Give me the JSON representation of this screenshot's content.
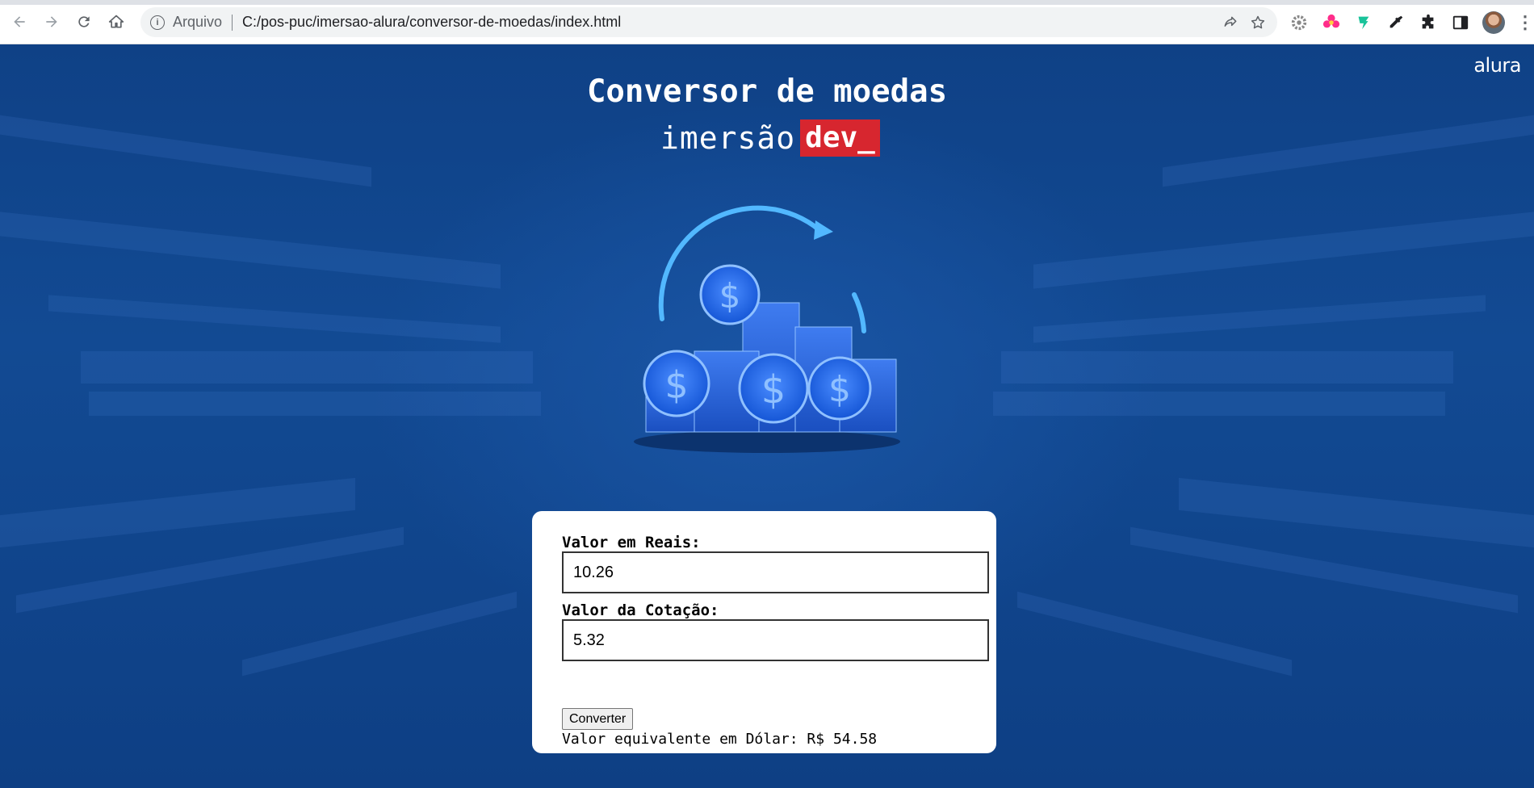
{
  "browser": {
    "security_label": "Arquivo",
    "url": "C:/pos-puc/imersao-alura/conversor-de-moedas/index.html",
    "icons": {
      "back": "back-arrow-icon",
      "forward": "forward-arrow-icon",
      "reload": "reload-icon",
      "home": "home-icon",
      "info": "info-icon",
      "share": "share-icon",
      "bookmark": "star-icon",
      "extensions": "puzzle-icon",
      "sidepanel": "side-panel-icon",
      "menu": "more-vert-icon"
    }
  },
  "page": {
    "brand": "alura",
    "title": "Conversor de moedas",
    "subtitle_light": "imersão",
    "subtitle_tag": "dev_",
    "illustration": "coins-stack-illustration"
  },
  "form": {
    "reais_label": "Valor em Reais:",
    "reais_value": "10.26",
    "cotacao_label": "Valor da Cotação:",
    "cotacao_value": "5.32",
    "convert_button": "Converter",
    "result_text": "Valor equivalente em Dólar: R$ 54.58"
  },
  "colors": {
    "background": "#0f4186",
    "tag_red": "#d7262f",
    "card": "#ffffff"
  }
}
